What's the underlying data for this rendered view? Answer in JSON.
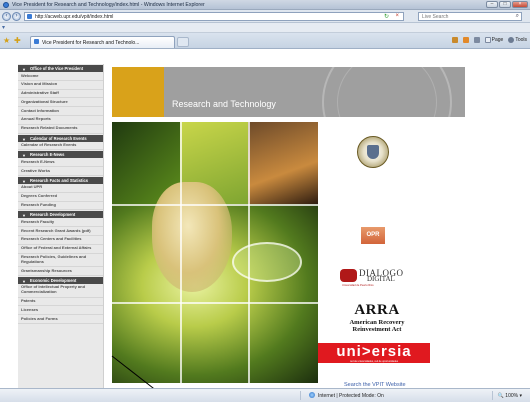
{
  "window": {
    "title": "Vice President for Research and Technology/index.html - Windows Internet Explorer"
  },
  "address": {
    "url": "http://acweb.upr.edu/vpit/index.html",
    "search_placeholder": "Live Search"
  },
  "tab": {
    "label": "Vice President for Research and Technolo..."
  },
  "command_bar": {
    "page_label": "Page",
    "tools_label": "Tools"
  },
  "sidebar": {
    "sections": [
      {
        "heading": "Office of the Vice President",
        "items": [
          "Welcome",
          "Vision and Mission",
          "Administrative Staff",
          "Organizational Structure",
          "Contact Information",
          "Annual Reports",
          "Research Related Documents"
        ]
      },
      {
        "heading": "Calendar of Research Events",
        "items": [
          "Calendar of Research Events"
        ]
      },
      {
        "heading": "Research E-News",
        "items": [
          "Research E-News",
          "Creative Works"
        ]
      },
      {
        "heading": "Research Facts and Statistics",
        "items": [
          "About UPR",
          "Degrees Conferred",
          "Research Funding"
        ]
      },
      {
        "heading": "Research Development",
        "items": [
          "Research Faculty",
          "Recent Research Grant Awards (pdf)",
          "Research Centers and Facilities",
          "Office of Federal and External Affairs",
          "Research Policies, Guidelines and Regulations",
          "Grantsmanship Resources"
        ]
      },
      {
        "heading": "Economic Development",
        "items": [
          "Office of Intellectual Property and Commercialization",
          "Patents",
          "Licenses",
          "Policies and Forms"
        ]
      }
    ]
  },
  "banner": {
    "title": "Research and Technology"
  },
  "logos": {
    "opr": "OPR",
    "dialogo_line1": "DIALOGO",
    "dialogo_line2": "DIGITAL",
    "dialogo_sub": "Universidad de Puerto Rico",
    "arra_title": "ARRA",
    "arra_line1": "American Recovery",
    "arra_line2": "Reinvestment Act",
    "universia": "uni>ersia",
    "universia_sub": "red de universidades, red de oportunidades"
  },
  "links": {
    "vpit_search": "Search the VPIT Website"
  },
  "status": {
    "zone": "Internet | Protected Mode: On",
    "zoom": "100%"
  }
}
